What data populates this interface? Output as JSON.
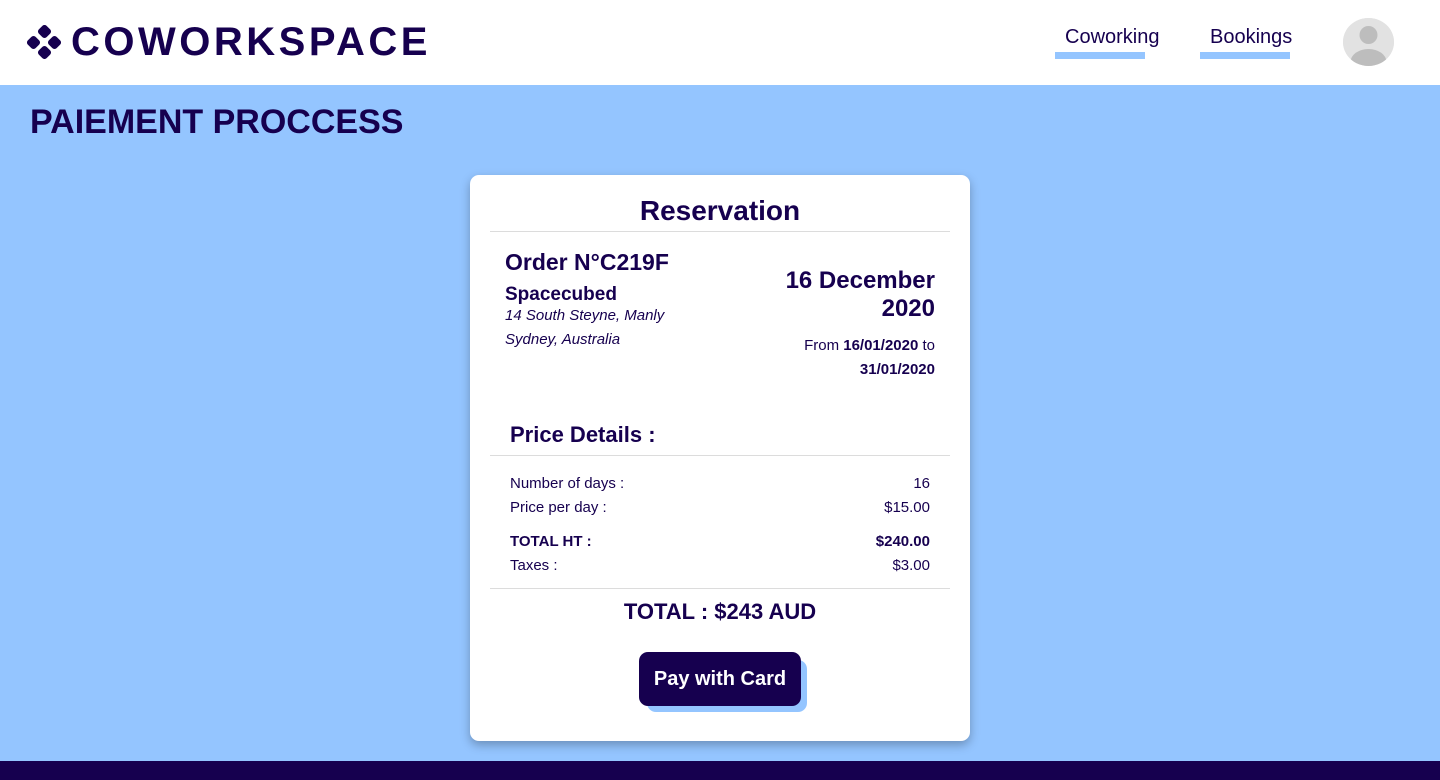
{
  "header": {
    "brand": "COWORKSPACE",
    "logo_icon": "four-diamond-logo-icon",
    "nav": [
      {
        "label": "Coworking"
      },
      {
        "label": "Bookings"
      }
    ],
    "avatar_icon": "user-avatar-icon"
  },
  "page": {
    "title": "PAIEMENT PROCCESS"
  },
  "reservation": {
    "title": "Reservation",
    "order": "Order N°C219F",
    "space_name": "Spacecubed",
    "address_line1": "14 South Steyne, Manly",
    "address_line2": "Sydney, Australia",
    "date_line1": "16 December",
    "date_line2": "2020",
    "range_from_label": "From",
    "range_from": "16/01/2020",
    "range_to_label": "to",
    "range_to": "31/01/2020"
  },
  "price_details": {
    "title": "Price Details :",
    "rows": [
      {
        "label": "Number of days :",
        "value": "16"
      },
      {
        "label": "Price per day :",
        "value": "$15.00"
      },
      {
        "label": "TOTAL HT :",
        "value": "$240.00"
      },
      {
        "label": "Taxes :",
        "value": "$3.00"
      }
    ],
    "total": "TOTAL : $243 AUD"
  },
  "actions": {
    "pay_label": "Pay with Card"
  },
  "colors": {
    "navy": "#16004f",
    "light_blue": "#94c5ff",
    "white": "#ffffff"
  }
}
